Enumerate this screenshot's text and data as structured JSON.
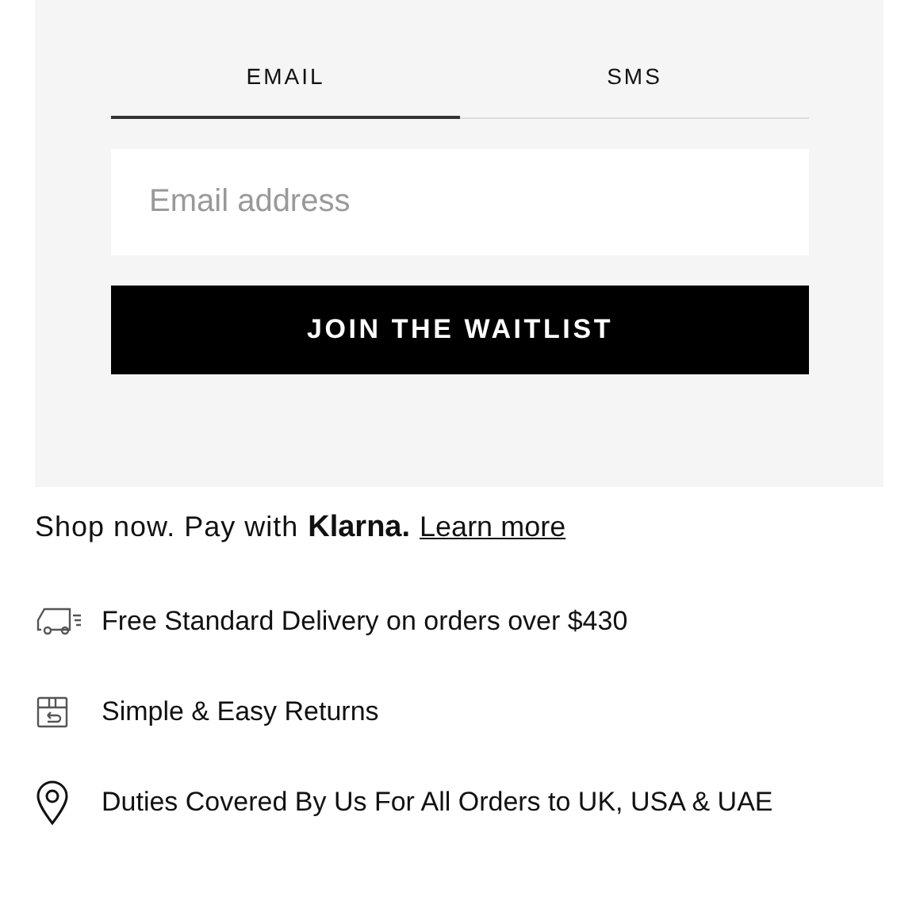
{
  "signup": {
    "tabs": [
      {
        "label": "EMAIL",
        "selected": true
      },
      {
        "label": "SMS",
        "selected": false
      }
    ],
    "email_field": {
      "placeholder": "Email address"
    },
    "button": "JOIN THE WAITLIST"
  },
  "payment": {
    "text": "Shop now. Pay with",
    "brand": "Klarna.",
    "link": "Learn more"
  },
  "features": [
    {
      "kind": "delivery",
      "text": "Free Standard Delivery on orders over $430"
    },
    {
      "kind": "returns",
      "text": "Simple & Easy Returns"
    },
    {
      "kind": "duties",
      "text": "Duties Covered By Us For All Orders to UK, USA & UAE"
    }
  ]
}
